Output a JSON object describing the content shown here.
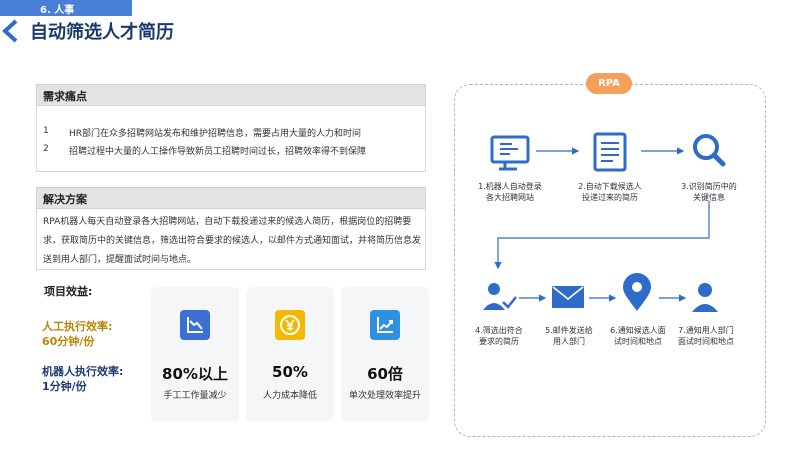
{
  "header": {
    "section_tag": "6. 人事",
    "title": "自动筛选人才简历"
  },
  "pain_points": {
    "heading": "需求痛点",
    "items": [
      {
        "num": "1",
        "text": "HR部门在众多招聘网站发布和维护招聘信息，需要占用大量的人力和时间"
      },
      {
        "num": "2",
        "text": "招聘过程中大量的人工操作导致新员工招聘时间过长，招聘效率得不到保障"
      }
    ]
  },
  "solution": {
    "heading": "解决方案",
    "text": "RPA机器人每天自动登录各大招聘网站，自动下载投递过来的候选人简历，根据岗位的招聘要求，获取简历中的关键信息，筛选出符合要求的候选人，以邮件方式通知面试，并将简历信息发送到用人部门，提醒面试时间与地点。"
  },
  "effects": {
    "title": "项目效益:",
    "manual_rate": {
      "label": "人工执行效率:",
      "value": "60分钟/份"
    },
    "robot_rate": {
      "label": "机器人执行效率:",
      "value": "1分钟/份"
    },
    "cards": [
      {
        "value": "80%以上",
        "label": "手工工作量减少",
        "icon": "chart-down-icon",
        "color": "#3b6fd6"
      },
      {
        "value": "50%",
        "label": "人力成本降低",
        "icon": "yen-coin-icon",
        "color": "#f5b800"
      },
      {
        "value": "60倍",
        "label": "单次处理效率提升",
        "icon": "chart-up-icon",
        "color": "#2f8fe0"
      }
    ]
  },
  "rpa": {
    "badge": "RPA",
    "steps": [
      {
        "line1": "1.机器人自动登录",
        "line2": "各大招聘网站",
        "icon": "monitor-icon"
      },
      {
        "line1": "2.自动下载候选人",
        "line2": "投递过来的简历",
        "icon": "document-icon"
      },
      {
        "line1": "3.识别简历中的",
        "line2": "关键信息",
        "icon": "magnifier-icon"
      },
      {
        "line1": "4.筛选出符合",
        "line2": "要求的简历",
        "icon": "user-select-icon"
      },
      {
        "line1": "5.邮件发送给",
        "line2": "用人部门",
        "icon": "mail-icon"
      },
      {
        "line1": "6.通知候选人面",
        "line2": "试时间和地点",
        "icon": "location-pin-icon"
      },
      {
        "line1": "7.通知用人部门",
        "line2": "面试时间和地点",
        "icon": "person-icon"
      }
    ]
  },
  "colors": {
    "accent": "#4a7fd8",
    "title": "#1a3a6e",
    "flow": "#2f6bc9",
    "badge": "#f4a05a",
    "gold": "#b8860b"
  }
}
